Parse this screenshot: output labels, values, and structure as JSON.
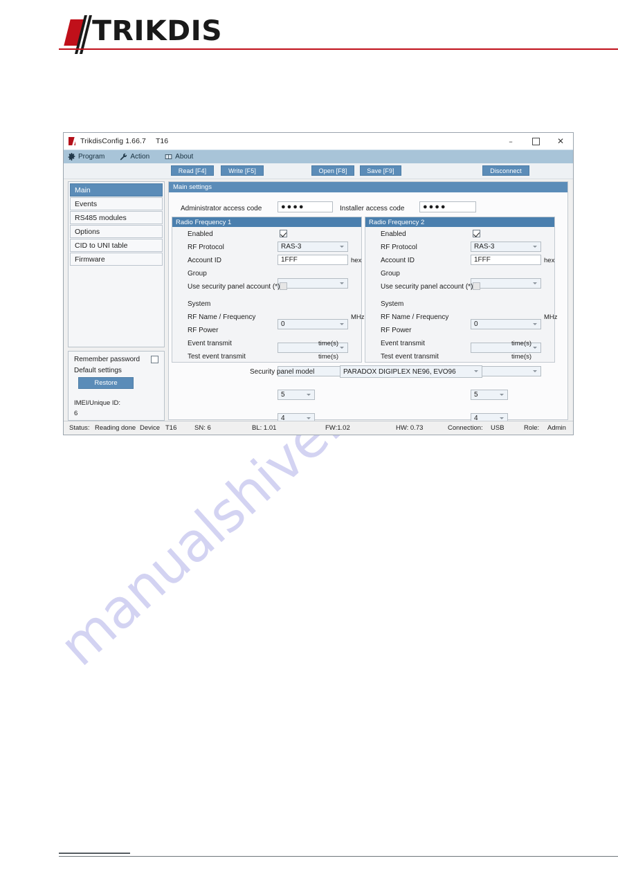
{
  "document": {
    "brand_name": "TRIKDIS",
    "brand_red": "#c0101a",
    "watermark_text": "manualshive.com"
  },
  "window": {
    "title": "TrikdisConfig 1.66.7",
    "model": "T16",
    "app_icon": "trikdis-icon",
    "controls": {
      "minimize": "–",
      "maximize": "maximize-icon",
      "close": "✕"
    }
  },
  "menubar": {
    "items": [
      {
        "label": "Program",
        "icon": "gear-icon"
      },
      {
        "label": "Action",
        "icon": "wrench-icon"
      },
      {
        "label": "About",
        "icon": "book-icon"
      }
    ]
  },
  "toolbar": {
    "read_label": "Read [F4]",
    "write_label": "Write [F5]",
    "open_label": "Open [F8]",
    "save_label": "Save [F9]",
    "disconnect_label": "Disconnect",
    "accent_color": "#5b8cb8"
  },
  "sidebar": {
    "items": [
      {
        "label": "Main",
        "active": true
      },
      {
        "label": "Events",
        "active": false
      },
      {
        "label": "RS485 modules",
        "active": false
      },
      {
        "label": "Options",
        "active": false
      },
      {
        "label": "CID to UNI table",
        "active": false
      },
      {
        "label": "Firmware",
        "active": false
      }
    ],
    "remember_password_label": "Remember password",
    "remember_password_checked": false,
    "default_settings_label": "Default settings",
    "restore_label": "Restore",
    "imei_label": "IMEI/Unique ID:",
    "imei_value": "6"
  },
  "content": {
    "header": "Main settings",
    "administrator_access_code_label": "Administrator access code",
    "administrator_access_code_value": "●●●●",
    "installer_access_code_label": "Installer access code",
    "installer_access_code_value": "●●●●",
    "security_panel_model_label": "Security panel model",
    "security_panel_model_value": "PARADOX DIGIPLEX NE96, EVO96"
  },
  "radio_frequency_1": {
    "title": "Radio Frequency 1",
    "enabled_label": "Enabled",
    "enabled_checked": true,
    "rf_protocol_label": "RF Protocol",
    "rf_protocol_value": "RAS-3",
    "account_id_label": "Account ID",
    "account_id_value": "1FFF",
    "account_id_suffix": "hex",
    "group_label": "Group",
    "group_value": "",
    "use_security_panel_account_label": "Use security panel account (*)",
    "use_security_panel_account_checked": false,
    "system_label": "System",
    "system_value": "0",
    "rf_name_frequency_label": "RF Name / Frequency",
    "rf_name_frequency_value": "",
    "rf_name_frequency_suffix": "MHz",
    "rf_power_label": "RF Power",
    "rf_power_value": "",
    "event_transmit_label": "Event transmit",
    "event_transmit_value": "5",
    "event_transmit_suffix": "time(s)",
    "test_event_transmit_label": "Test event transmit",
    "test_event_transmit_value": "4",
    "test_event_transmit_suffix": "time(s)"
  },
  "radio_frequency_2": {
    "title": "Radio Frequency 2",
    "enabled_label": "Enabled",
    "enabled_checked": true,
    "rf_protocol_label": "RF Protocol",
    "rf_protocol_value": "RAS-3",
    "account_id_label": "Account ID",
    "account_id_value": "1FFF",
    "account_id_suffix": "hex",
    "group_label": "Group",
    "group_value": "",
    "use_security_panel_account_label": "Use security panel account (*)",
    "use_security_panel_account_checked": false,
    "system_label": "System",
    "system_value": "0",
    "rf_name_frequency_label": "RF Name / Frequency",
    "rf_name_frequency_value": "",
    "rf_name_frequency_suffix": "MHz",
    "rf_power_label": "RF Power",
    "rf_power_value": "",
    "event_transmit_label": "Event transmit",
    "event_transmit_value": "5",
    "event_transmit_suffix": "time(s)",
    "test_event_transmit_label": "Test event transmit",
    "test_event_transmit_value": "4",
    "test_event_transmit_suffix": "time(s)"
  },
  "statusbar": {
    "status_label": "Status:",
    "status_value": "Reading done",
    "device_label": "Device",
    "device_value": "T16",
    "sn": "SN: 6",
    "bl": "BL: 1.01",
    "fw": "FW:1.02",
    "hw": "HW: 0.73",
    "connection_label": "Connection:",
    "connection_value": "USB",
    "role_label": "Role:",
    "role_value": "Admin"
  }
}
